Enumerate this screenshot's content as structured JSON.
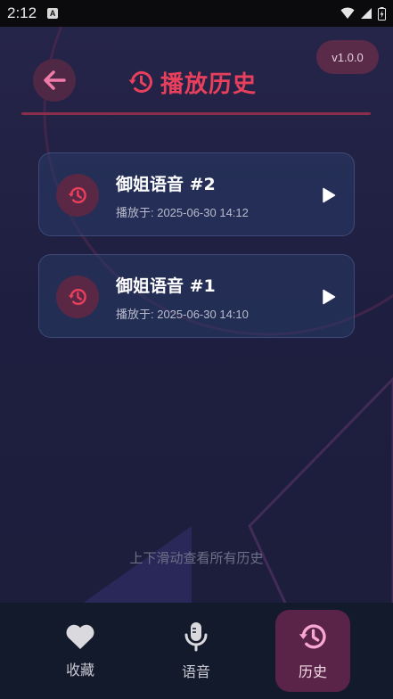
{
  "status_bar": {
    "time": "2:12",
    "notification_glyph": "A"
  },
  "header": {
    "version": "v1.0.0",
    "title": "播放历史"
  },
  "history": [
    {
      "title": "御姐语音 #2",
      "played_at": "播放于: 2025-06-30 14:12"
    },
    {
      "title": "御姐语音 #1",
      "played_at": "播放于: 2025-06-30 14:10"
    }
  ],
  "scroll_hint": "上下滑动查看所有历史",
  "nav": {
    "items": [
      {
        "label": "收藏",
        "icon": "heart-icon"
      },
      {
        "label": "语音",
        "icon": "microphone-icon"
      },
      {
        "label": "历史",
        "icon": "history-icon",
        "active": true
      }
    ]
  },
  "colors": {
    "accent": "#e8405c",
    "background": "#1f2040",
    "nav_background": "#131a2c",
    "active_tab": "#5a2348"
  }
}
